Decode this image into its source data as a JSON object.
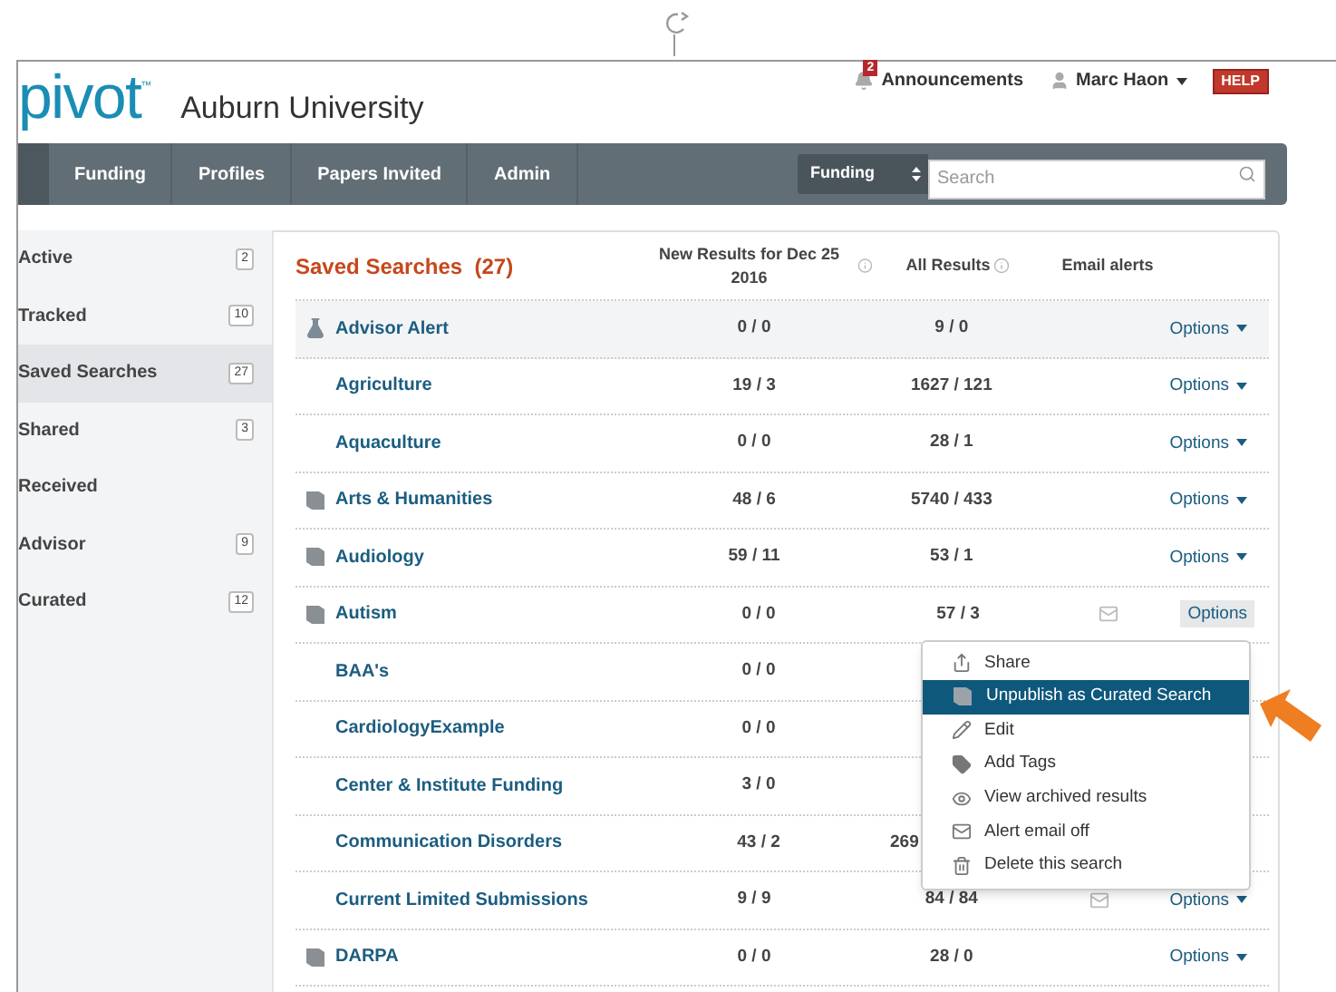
{
  "header": {
    "logo": "pivot",
    "logo_mark": "™",
    "institution": "Auburn University",
    "announcements": {
      "badge": "2",
      "label": "Announcements"
    },
    "user": "Marc Haon",
    "help": "HELP"
  },
  "nav": {
    "tabs": [
      {
        "label": "Funding",
        "selected": false
      },
      {
        "label": "Profiles",
        "selected": false
      },
      {
        "label": "Papers Invited",
        "selected": false
      },
      {
        "label": "Admin",
        "selected": false
      }
    ],
    "scope": "Funding",
    "search": {
      "placeholder": "Search"
    }
  },
  "sidebar": {
    "items": [
      {
        "label": "Active",
        "count": "2",
        "selected": false
      },
      {
        "label": "Tracked",
        "count": "10",
        "selected": false
      },
      {
        "label": "Saved Searches",
        "count": "27",
        "selected": true
      },
      {
        "label": "Shared",
        "count": "3",
        "selected": false
      },
      {
        "label": "Received",
        "selected": false
      },
      {
        "label": "Advisor",
        "count": "9",
        "selected": false
      },
      {
        "label": "Curated",
        "count": "12",
        "selected": false
      }
    ]
  },
  "table": {
    "title": "Saved Searches  (27)",
    "columns": [
      "New Results for Dec 25 2016",
      "All Results",
      "Email alerts"
    ],
    "rows": [
      {
        "name": "Advisor Alert",
        "kind": "advisor",
        "new": "0 / 0",
        "all": "9 / 0",
        "email": false,
        "options": "Options",
        "open": false,
        "highlighted": true
      },
      {
        "name": "Agriculture",
        "kind": "plain",
        "new": "19 / 3",
        "all": "1627 / 121",
        "email": false,
        "options": "Options",
        "open": false,
        "highlighted": false
      },
      {
        "name": "Aquaculture",
        "kind": "plain",
        "new": "0 / 0",
        "all": "28 / 1",
        "email": false,
        "options": "Options",
        "open": false,
        "highlighted": false
      },
      {
        "name": "Arts & Humanities",
        "kind": "curated",
        "new": "48 / 6",
        "all": "5740 / 433",
        "email": false,
        "options": "Options",
        "open": false,
        "highlighted": false
      },
      {
        "name": "Audiology",
        "kind": "curated",
        "new": "59 / 11",
        "all": "53 / 1",
        "email": false,
        "options": "Options",
        "open": false,
        "highlighted": false
      },
      {
        "name": "Autism",
        "kind": "curated",
        "new": "0 / 0",
        "all": "57 / 3",
        "email": true,
        "options": "Options",
        "open": true,
        "highlighted": false
      },
      {
        "name": "BAA's",
        "kind": "plain",
        "new": "0 / 0",
        "highlighted": false
      },
      {
        "name": "CardiologyExample",
        "kind": "plain",
        "new": "0 / 0",
        "highlighted": false
      },
      {
        "name": "Center & Institute Funding",
        "kind": "plain",
        "new": "3 / 0",
        "highlighted": false
      },
      {
        "name": "Communication Disorders",
        "kind": "plain",
        "new": "43 / 2",
        "all": "269",
        "highlighted": false
      },
      {
        "name": "Current Limited Submissions",
        "kind": "plain",
        "new": "9 / 9",
        "all": "84 / 84",
        "email": true,
        "options": "Options",
        "open": false,
        "highlighted": false
      },
      {
        "name": "DARPA",
        "kind": "curated",
        "new": "0 / 0",
        "all": "28 / 0",
        "email": false,
        "options": "Options",
        "open": false,
        "highlighted": false
      }
    ]
  },
  "menu": {
    "items": [
      {
        "label": "Share",
        "kind": "share",
        "selected": false
      },
      {
        "label": "Unpublish as Curated Search",
        "kind": "curated",
        "selected": true
      },
      {
        "label": "Edit",
        "kind": "edit",
        "selected": false
      },
      {
        "label": "Add Tags",
        "kind": "tag",
        "selected": false
      },
      {
        "label": "View archived results",
        "kind": "view",
        "selected": false
      },
      {
        "label": "Alert email off",
        "kind": "mail",
        "selected": false
      },
      {
        "label": "Delete this search",
        "kind": "delete",
        "selected": false
      }
    ]
  }
}
